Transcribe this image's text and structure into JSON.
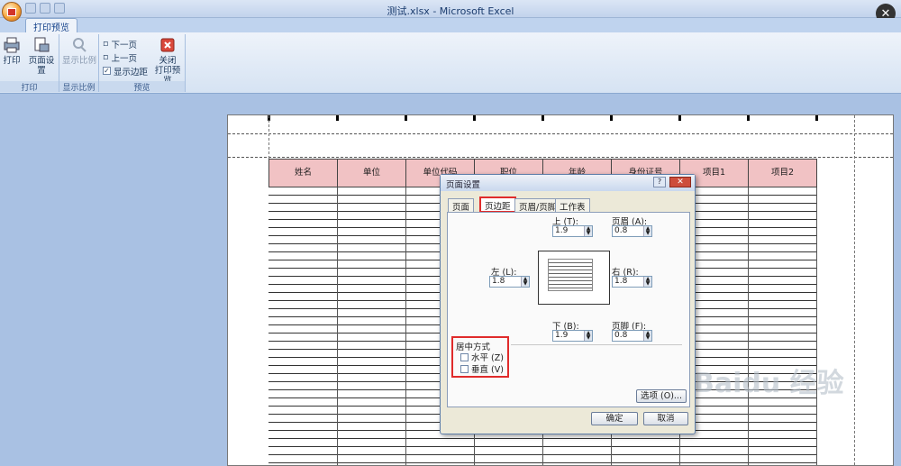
{
  "window": {
    "title": "测试.xlsx - Microsoft Excel"
  },
  "ribbon": {
    "tab": "打印预览",
    "groups": [
      {
        "label": "打印",
        "buttons": [
          "打印",
          "页面设置"
        ]
      },
      {
        "label": "显示比例",
        "buttons": [
          "显示比例"
        ]
      },
      {
        "label": "预览",
        "buttons": [
          "下一页",
          "上一页",
          "显示边距"
        ],
        "close_line1": "关闭",
        "close_line2": "打印预览",
        "show_margins_checked": true
      }
    ]
  },
  "sheet": {
    "headers": [
      "姓名",
      "单位",
      "单位代码",
      "职位",
      "年龄",
      "身份证号",
      "项目1",
      "项目2"
    ],
    "header_color": "#f1c2c4"
  },
  "dialog": {
    "title": "页面设置",
    "help": "?",
    "close": "✕",
    "tabs": [
      "页面",
      "页边距",
      "页眉/页脚",
      "工作表"
    ],
    "active_tab": "页边距",
    "top": {
      "label": "上 (T):",
      "value": "1.9"
    },
    "header": {
      "label": "页眉 (A):",
      "value": "0.8"
    },
    "left": {
      "label": "左 (L):",
      "value": "1.8"
    },
    "right": {
      "label": "右 (R):",
      "value": "1.8"
    },
    "bottom": {
      "label": "下 (B):",
      "value": "1.9"
    },
    "footer": {
      "label": "页脚 (F):",
      "value": "0.8"
    },
    "center": {
      "title": "居中方式",
      "horizontal": "水平 (Z)",
      "vertical": "垂直 (V)"
    },
    "options_button": "选项 (O)...",
    "ok": "确定",
    "cancel": "取消"
  },
  "watermark": "Baidu 经验"
}
